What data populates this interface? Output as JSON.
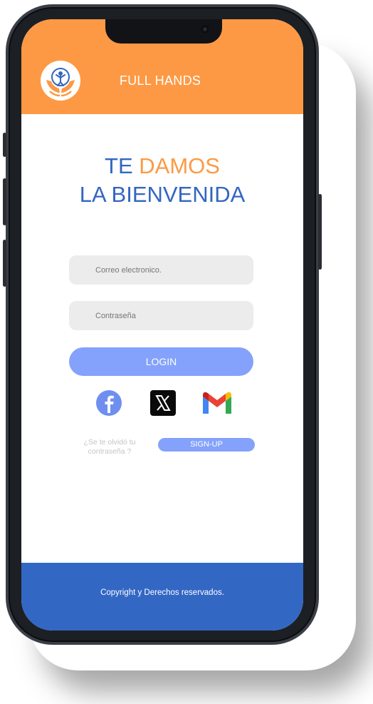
{
  "app": {
    "title": "FULL HANDS"
  },
  "welcome": {
    "line1_prefix": "TE ",
    "line1_accent": "DAMOS",
    "line2": "LA BIENVENIDA"
  },
  "form": {
    "email_placeholder": "Correo electronico.",
    "password_placeholder": "Contraseña",
    "login_label": "LOGIN"
  },
  "social": [
    {
      "icon": "facebook-icon"
    },
    {
      "icon": "x-icon"
    },
    {
      "icon": "gmail-icon"
    }
  ],
  "forgot_password": "¿Se te olvidó tu contraseña ?",
  "signup_label": "SIGN-UP",
  "footer": {
    "copyright": "Copyright  y Derechos reservados."
  },
  "colors": {
    "header": "#fd9944",
    "footer": "#3367c4",
    "primary_button": "#84a2fb",
    "title_blue": "#3366c0",
    "title_orange": "#fd9944"
  }
}
